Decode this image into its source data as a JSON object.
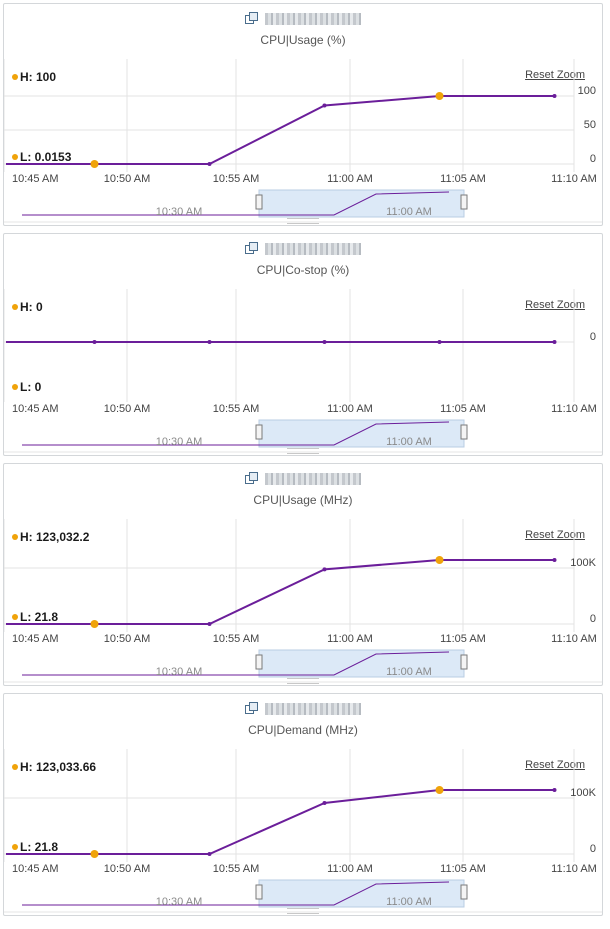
{
  "colors": {
    "series": "#6b1e9a",
    "marker": "#f0a30a",
    "grid": "#e3e3e3",
    "nav_window": "#dce9f7"
  },
  "reset_zoom_label": "Reset Zoom",
  "nav_labels": [
    "10:30 AM",
    "11:00 AM"
  ],
  "panels": [
    {
      "title": "CPU|Usage (%)",
      "high_label": "H: 100",
      "low_label": "L: 0.0153",
      "chart_data": {
        "type": "line",
        "x": [
          "10:48:30",
          "10:53:30",
          "10:58:30",
          "11:03:30",
          "11:08:30"
        ],
        "values": [
          0.0153,
          0.0153,
          86,
          100,
          100
        ],
        "x_ticks": [
          "10:45 AM",
          "10:50 AM",
          "10:55 AM",
          "11:00 AM",
          "11:05 AM",
          "11:10 AM"
        ],
        "y_ticks": [
          "100",
          "50",
          "0"
        ],
        "ylim": [
          0,
          100
        ],
        "highlight_low_index": 0,
        "highlight_high_index": 3
      }
    },
    {
      "title": "CPU|Co-stop (%)",
      "high_label": "H: 0",
      "low_label": "L: 0",
      "chart_data": {
        "type": "line",
        "x": [
          "10:48:30",
          "10:53:30",
          "10:58:30",
          "11:03:30",
          "11:08:30"
        ],
        "values": [
          0,
          0,
          0,
          0,
          0
        ],
        "x_ticks": [
          "10:45 AM",
          "10:50 AM",
          "10:55 AM",
          "11:00 AM",
          "11:05 AM",
          "11:10 AM"
        ],
        "y_ticks": [
          "0"
        ],
        "ylim": [
          0,
          0
        ]
      }
    },
    {
      "title": "CPU|Usage (MHz)",
      "high_label": "H: 123,032.2",
      "low_label": "L: 21.8",
      "chart_data": {
        "type": "line",
        "x": [
          "10:48:30",
          "10:53:30",
          "10:58:30",
          "11:03:30",
          "11:08:30"
        ],
        "values": [
          21.8,
          21.8,
          105000,
          123032.2,
          123032.2
        ],
        "x_ticks": [
          "10:45 AM",
          "10:50 AM",
          "10:55 AM",
          "11:00 AM",
          "11:05 AM",
          "11:10 AM"
        ],
        "y_ticks": [
          "100K",
          "0"
        ],
        "ylim": [
          0,
          123032.2
        ],
        "highlight_low_index": 0,
        "highlight_high_index": 3
      }
    },
    {
      "title": "CPU|Demand (MHz)",
      "high_label": "H: 123,033.66",
      "low_label": "L: 21.8",
      "chart_data": {
        "type": "line",
        "x": [
          "10:48:30",
          "10:53:30",
          "10:58:30",
          "11:03:30",
          "11:08:30"
        ],
        "values": [
          21.8,
          21.8,
          98000,
          123033.66,
          123033.66
        ],
        "x_ticks": [
          "10:45 AM",
          "10:50 AM",
          "10:55 AM",
          "11:00 AM",
          "11:05 AM",
          "11:10 AM"
        ],
        "y_ticks": [
          "100K",
          "0"
        ],
        "ylim": [
          0,
          123033.66
        ],
        "highlight_low_index": 0,
        "highlight_high_index": 3
      }
    }
  ]
}
